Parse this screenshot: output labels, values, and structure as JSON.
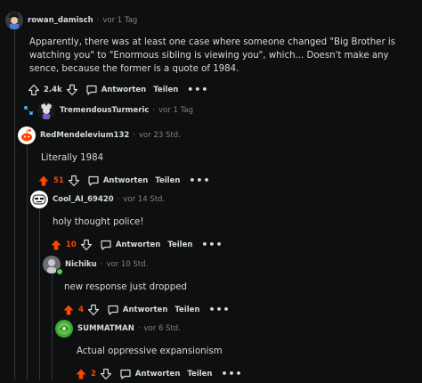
{
  "comments": [
    {
      "user": "rowan_damisch",
      "time": "vor 1 Tag",
      "body": "Apparently, there was at least one case where someone changed \"Big Brother is watching you\" to \"Enormous sibling is viewing you\", which... Doesn't make any sence, because the former is a quote of 1984.",
      "score": "2.4k",
      "reply_label": "Antworten",
      "share_label": "Teilen",
      "more": "•••",
      "upvoted": false
    },
    {
      "user": "TremendousTurmeric",
      "time": "vor 1 Tag",
      "collapsed": true
    },
    {
      "user": "RedMendelevium132",
      "time": "vor 23 Std.",
      "body": "Literally 1984",
      "score": "51",
      "reply_label": "Antworten",
      "share_label": "Teilen",
      "more": "•••",
      "upvoted": true
    },
    {
      "user": "Cool_AI_69420",
      "time": "vor 14 Std.",
      "body": "holy thought police!",
      "score": "10",
      "reply_label": "Antworten",
      "share_label": "Teilen",
      "more": "•••",
      "upvoted": true
    },
    {
      "user": "Nichiku",
      "time": "vor 10 Std.",
      "body": "new response just dropped",
      "score": "4",
      "reply_label": "Antworten",
      "share_label": "Teilen",
      "more": "•••",
      "upvoted": true,
      "online": true
    },
    {
      "user": "SUMMATMAN",
      "time": "vor 6 Std.",
      "body": "Actual oppressive expansionism",
      "score": "2",
      "reply_label": "Antworten",
      "share_label": "Teilen",
      "more": "•••",
      "upvoted": true
    }
  ],
  "separator": "·",
  "colors": {
    "background": "#0e0f10",
    "upvote": "#ff4500",
    "text": "#d7dadc",
    "muted": "#818384",
    "rail": "#343536",
    "online": "#46d160"
  },
  "icons": {
    "upvote": "arrow-up-icon",
    "downvote": "arrow-down-icon",
    "reply": "comment-bubble-icon",
    "more": "more-horizontal-icon",
    "expand": "expand-icon"
  }
}
